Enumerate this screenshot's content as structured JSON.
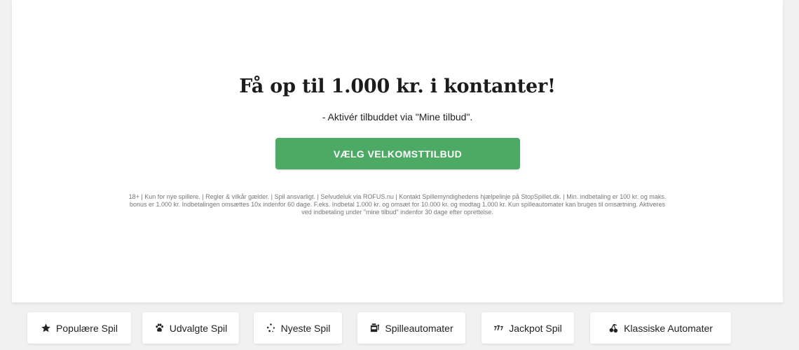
{
  "hero": {
    "title": "Få op til 1.000 kr. i kontanter!",
    "subtitle": "- Aktivér tilbuddet via \"Mine tilbud\".",
    "cta_label": "VÆLG VELKOMSTTILBUD",
    "terms": "18+ | Kun for nye spillere. | Regler & vilkår gælder. | Spil ansvarligt. | Selvudeluk via ROFUS.nu | Kontakt Spillemyndighedens hjælpelinje på StopSpillet.dk. | Min. indbetaling er 100 kr. og maks. bonus er 1.000 kr. Indbetalingen omsættes 10x indenfor 60 dage. F.eks. Indbetal 1.000 kr. og omsæt for 10.000 kr. og modtag 1.000 kr. Kun spilleautomater kan bruges til omsætning. Aktiveres ved indbetaling under \"mine tilbud\" indenfor 30 dage efter oprettelse."
  },
  "categories": [
    {
      "label": "Populære Spil",
      "icon": "star-icon"
    },
    {
      "label": "Udvalgte Spil",
      "icon": "paw-icon"
    },
    {
      "label": "Nyeste Spil",
      "icon": "sparkle-icon"
    },
    {
      "label": "Spilleautomater",
      "icon": "slot-machine-icon"
    },
    {
      "label": "Jackpot Spil",
      "icon": "sevens-icon"
    },
    {
      "label": "Klassiske Automater",
      "icon": "cherries-icon"
    }
  ],
  "colors": {
    "cta_green": "#4caa64",
    "background": "#f1f1f1",
    "card": "#ffffff"
  }
}
